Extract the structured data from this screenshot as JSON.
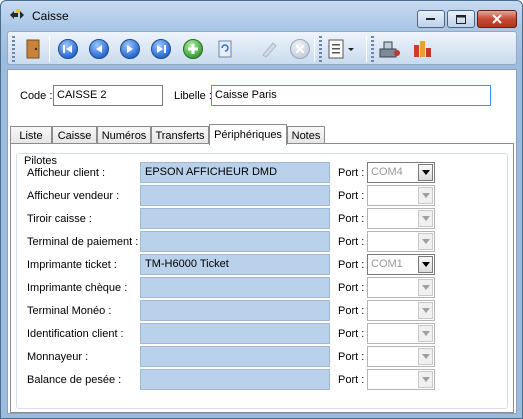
{
  "window": {
    "title": "Caisse"
  },
  "toolbar": {
    "icons": [
      "door-icon",
      "first-record-icon",
      "previous-record-icon",
      "next-record-icon",
      "last-record-icon",
      "add-icon",
      "refresh-icon",
      "edit-icon",
      "delete-icon",
      "report-icon",
      "tools-icon",
      "chart-icon"
    ]
  },
  "form": {
    "code_label": "Code :",
    "code_value": "CAISSE 2",
    "libelle_label": "Libelle :",
    "libelle_value": "Caisse Paris"
  },
  "tabs": [
    "Liste",
    "Caisse",
    "Numéros",
    "Transferts",
    "Périphériques",
    "Notes"
  ],
  "active_tab": "Périphériques",
  "pilotes": {
    "title": "Pilotes",
    "port_label": "Port :",
    "rows": [
      {
        "label": "Afficheur client :",
        "value": "EPSON AFFICHEUR DMD",
        "port": "COM4"
      },
      {
        "label": "Afficheur vendeur :",
        "value": "",
        "port": ""
      },
      {
        "label": "Tiroir caisse :",
        "value": "",
        "port": ""
      },
      {
        "label": "Terminal de paiement :",
        "value": "",
        "port": ""
      },
      {
        "label": "Imprimante ticket :",
        "value": "TM-H6000 Ticket",
        "port": "COM1"
      },
      {
        "label": "Imprimante chèque :",
        "value": "",
        "port": ""
      },
      {
        "label": "Terminal Monéo :",
        "value": "",
        "port": ""
      },
      {
        "label": "Identification client :",
        "value": "",
        "port": ""
      },
      {
        "label": "Monnayeur :",
        "value": "",
        "port": ""
      },
      {
        "label": "Balance de pesée :",
        "value": "",
        "port": ""
      }
    ]
  }
}
